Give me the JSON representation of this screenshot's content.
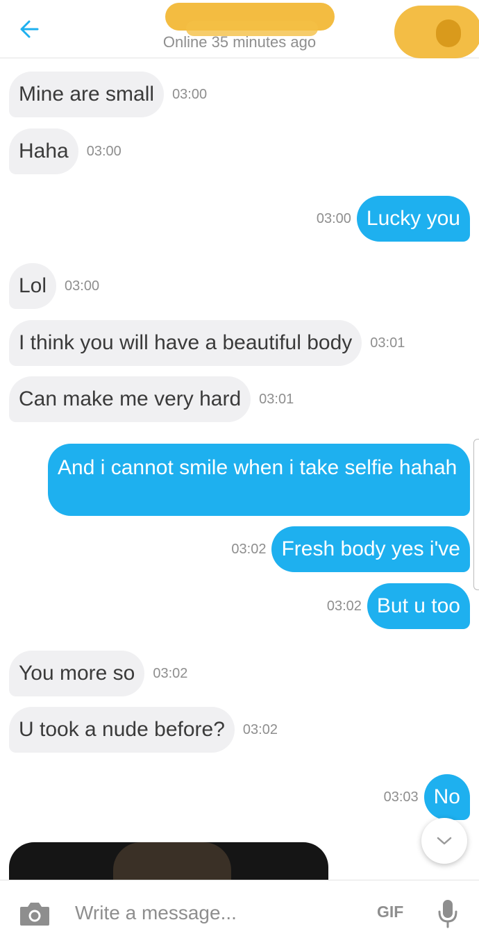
{
  "header": {
    "status": "Online 35 minutes ago",
    "accent_color": "#1eb0ef"
  },
  "messages": [
    {
      "text": "Mine are small",
      "time": "03:00",
      "direction": "incoming"
    },
    {
      "text": "Haha",
      "time": "03:00",
      "direction": "incoming"
    },
    {
      "text": "Lucky you",
      "time": "03:00",
      "direction": "outgoing"
    },
    {
      "text": "Lol",
      "time": "03:00",
      "direction": "incoming"
    },
    {
      "text": "I think you will have a beautiful body",
      "time": "03:01",
      "direction": "incoming"
    },
    {
      "text": "Can make me very hard",
      "time": "03:01",
      "direction": "incoming"
    },
    {
      "text": "And i cannot smile when i take selfie hahah",
      "direction": "outgoing"
    },
    {
      "text": "Fresh body yes i've",
      "time": "03:02",
      "direction": "outgoing"
    },
    {
      "text": "But u too",
      "time": "03:02",
      "direction": "outgoing"
    },
    {
      "text": "You more so",
      "time": "03:02",
      "direction": "incoming"
    },
    {
      "text": "U took a nude before?",
      "time": "03:02",
      "direction": "incoming"
    },
    {
      "text": "No",
      "time": "03:03",
      "direction": "outgoing"
    }
  ],
  "composer": {
    "placeholder": "Write a message...",
    "gif_label": "GIF",
    "icons": [
      "camera-icon",
      "microphone-icon"
    ]
  },
  "icons": {
    "back": "arrow-left-icon",
    "scroll_down": "chevron-down-icon"
  },
  "colors": {
    "incoming_bubble": "#f0f0f2",
    "outgoing_bubble": "#1eb0ef",
    "timestamp": "#8e8e8e"
  }
}
